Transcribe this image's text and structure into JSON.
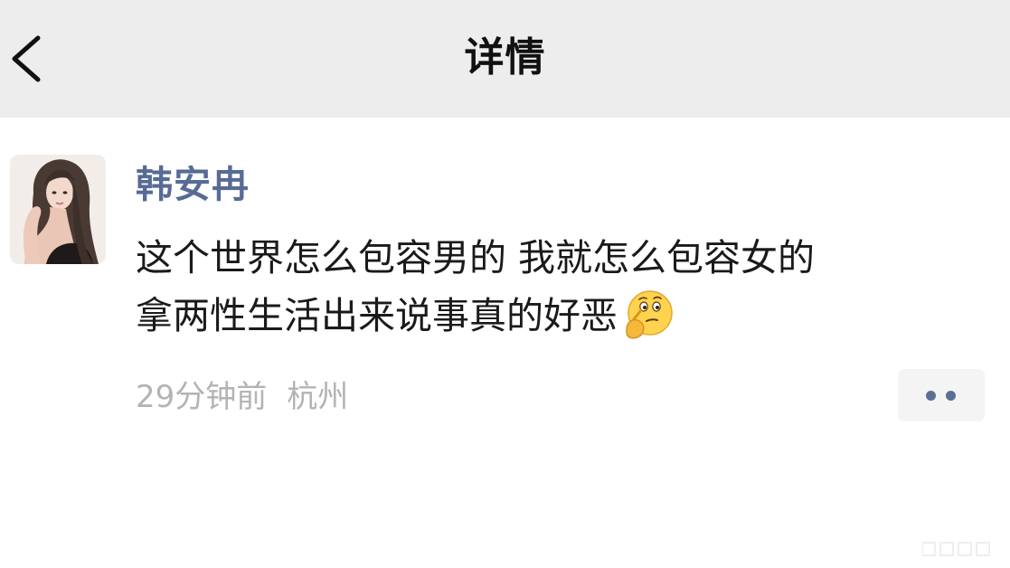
{
  "header": {
    "title": "详情",
    "back_icon": "chevron-left-icon"
  },
  "post": {
    "avatar_icon": "user-avatar",
    "username": "韩安冉",
    "lines": [
      "这个世界怎么包容男的 我就怎么包容女的",
      "拿两性生活出来说事真的好恶"
    ],
    "emoji_icon": "thinking-face-emoji",
    "time": "29分钟前",
    "location": "杭州",
    "more_icon": "more-dots-icon"
  },
  "colors": {
    "header_bg": "#ededed",
    "username": "#576b95",
    "body_text": "#1a1a1a",
    "meta_text": "#b3b3b3",
    "more_dots": "#5b6f95"
  }
}
